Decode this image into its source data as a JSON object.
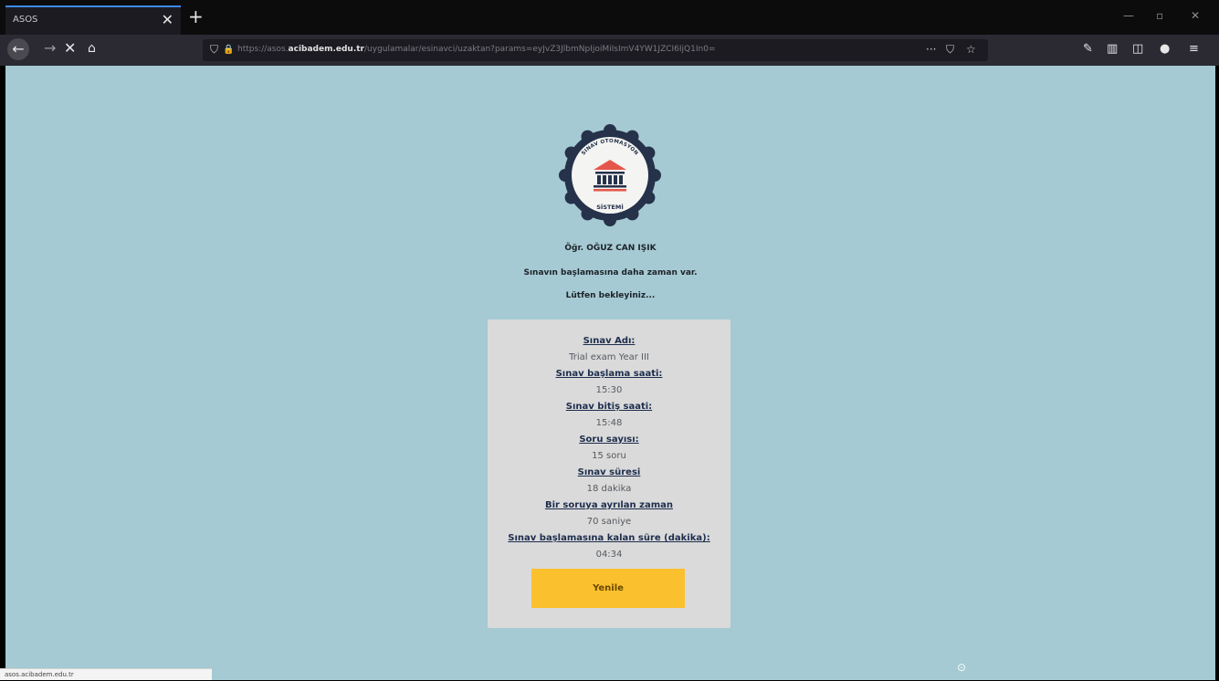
{
  "browser": {
    "tab_title": "ASOS",
    "tab_close": "✕",
    "new_tab": "+",
    "url_host": "https://asos.",
    "url_domain": "acibadem.edu.tr",
    "url_path": "/uygulamalar/esinavci/uzaktan?params=eyJvZ3JlbmNpIjoiMiIsImV4YW1JZCI6IjQ1In0=",
    "window_controls": {
      "minimize": "—",
      "restore": "▫",
      "close": "✕"
    },
    "status_text": "asos.acibadem.edu.tr"
  },
  "icons": {
    "back": "back-arrow-icon",
    "forward": "forward-arrow-icon",
    "stop": "stop-icon",
    "home": "home-icon",
    "shield": "shield-icon",
    "lock": "lock-icon",
    "more": "more-icon",
    "pocket": "pocket-icon",
    "star": "star-icon",
    "wrench": "wrench-icon",
    "library": "library-icon",
    "sidebar": "sidebar-icon",
    "account": "account-icon",
    "menu": "menu-icon"
  },
  "seal": {
    "top_text": "SINAV OTOMASYON",
    "bottom_text": "SİSTEMİ",
    "colors": {
      "ring": "#25324a",
      "roof": "#e5564a",
      "columns": "#25324a",
      "bg": "#f4f4f2"
    }
  },
  "student": {
    "name": "Öğr. OĞUZ CAN IŞIK",
    "message1": "Sınavın başlamasına daha zaman var.",
    "message2": "Lütfen bekleyiniz..."
  },
  "exam": {
    "name_label": "Sınav Adı:",
    "name_value": "Trial exam Year III",
    "start_label": "Sınav başlama saati:",
    "start_value": "15:30",
    "end_label": "Sınav bitiş saati:",
    "end_value": "15:48",
    "count_label": "Soru sayısı:",
    "count_value": "15 soru",
    "duration_label": "Sınav süresi",
    "duration_value": "18 dakika",
    "perq_label": "Bir soruya ayrılan zaman",
    "perq_value": "70 saniye",
    "remaining_label": "Sınav başlamasına kalan süre (dakika):",
    "remaining_value": "04:34",
    "refresh_button": "Yenile"
  },
  "colors": {
    "page_bg": "#a5cad3",
    "card_bg": "#dadada",
    "button_bg": "#fbc02d",
    "label_color": "#1d2d4d"
  }
}
